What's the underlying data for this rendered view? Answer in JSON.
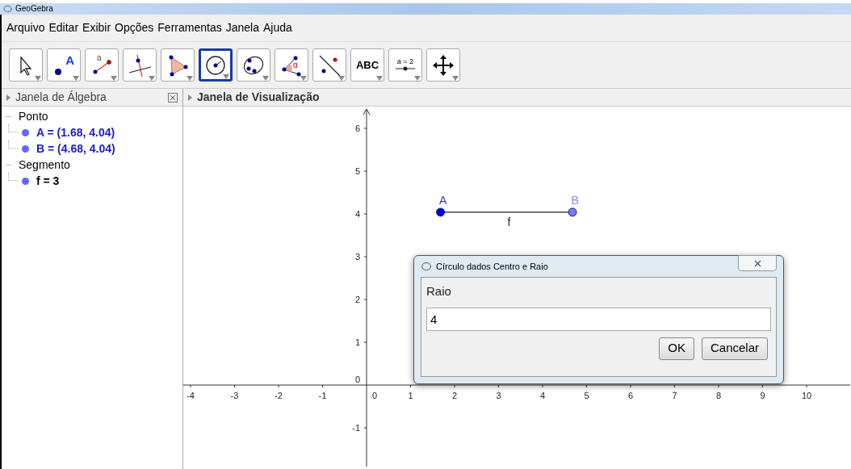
{
  "window": {
    "title": "GeoGebra"
  },
  "menu": [
    "Arquivo",
    "Editar",
    "Exibir",
    "Opções",
    "Ferramentas",
    "Janela",
    "Ajuda"
  ],
  "toolbar": [
    {
      "kind": "move",
      "selected": false
    },
    {
      "kind": "point",
      "label": "A",
      "selected": false
    },
    {
      "kind": "segment",
      "label": "a",
      "selected": false
    },
    {
      "kind": "perpendicular",
      "selected": false
    },
    {
      "kind": "polygon",
      "selected": false
    },
    {
      "kind": "circle",
      "selected": true
    },
    {
      "kind": "conic",
      "selected": false
    },
    {
      "kind": "angle",
      "label": "α",
      "selected": false
    },
    {
      "kind": "reflect",
      "selected": false
    },
    {
      "kind": "text",
      "label": "ABC",
      "selected": false
    },
    {
      "kind": "slider",
      "label": "a = 2",
      "selected": false
    },
    {
      "kind": "pan",
      "selected": false
    }
  ],
  "algebra": {
    "title": "Janela de Álgebra",
    "groups": [
      {
        "name": "Ponto",
        "expanded": true,
        "items": [
          {
            "text": "A = (1.68, 4.04)",
            "color": "#1a1ad0"
          },
          {
            "text": "B = (4.68, 4.04)",
            "color": "#1a1ad0"
          }
        ]
      },
      {
        "name": "Segmento",
        "expanded": true,
        "items": [
          {
            "text": "f = 3",
            "color": "#000000"
          }
        ]
      }
    ]
  },
  "graphics": {
    "title": "Janela de Visualização",
    "x_ticks": [
      "-4",
      "-3",
      "-2",
      "-1",
      "0",
      "1",
      "2",
      "3",
      "4",
      "5",
      "6",
      "7",
      "8",
      "9",
      "10"
    ],
    "y_ticks": [
      "6",
      "5",
      "4",
      "3",
      "2",
      "1",
      "0",
      "-1"
    ],
    "points": [
      {
        "label": "A",
        "highlighted": true
      },
      {
        "label": "B",
        "highlighted": false
      }
    ],
    "segment_label": "f"
  },
  "dialog": {
    "title": "Círculo dados Centro e Raio",
    "label": "Raio",
    "value": "4",
    "buttons": [
      "OK",
      "Cancelar"
    ]
  }
}
